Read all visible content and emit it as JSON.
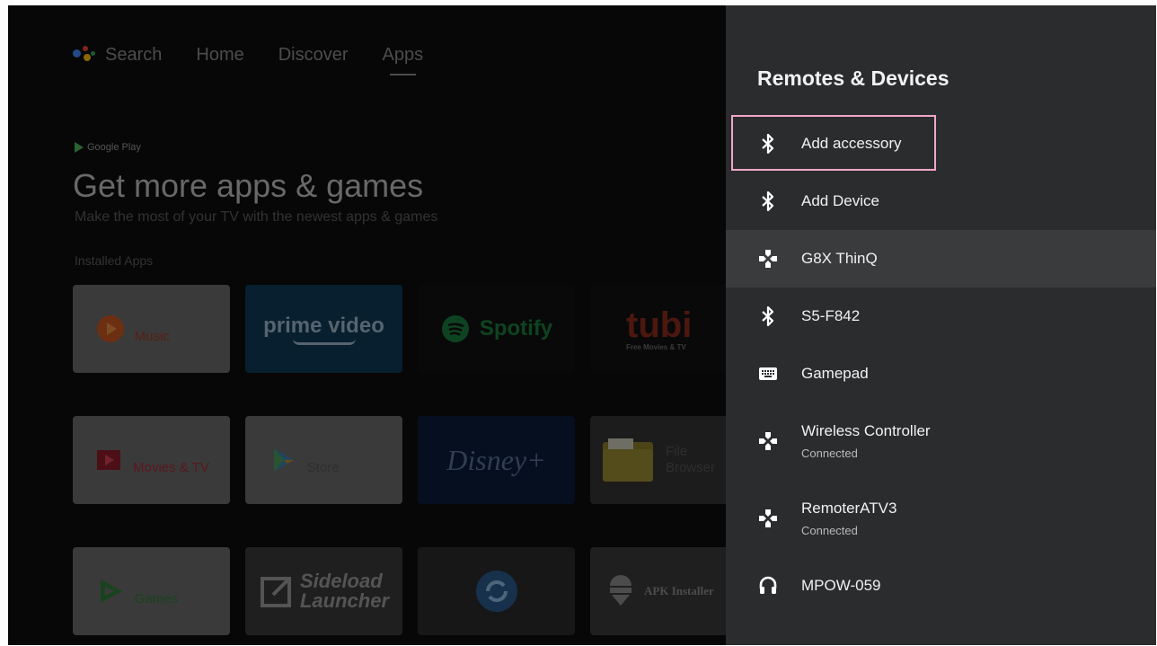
{
  "launcher": {
    "nav": {
      "search_label": "Search",
      "tabs": [
        {
          "label": "Home"
        },
        {
          "label": "Discover"
        },
        {
          "label": "Apps",
          "active": true
        }
      ]
    },
    "google_play_badge": "Google Play",
    "hero_title": "Get more apps & games",
    "hero_subtitle": "Make the most of your TV with the newest apps & games",
    "section_label": "Installed Apps",
    "apps": [
      {
        "line1": "Google Play",
        "line2": "Music"
      },
      {
        "line1": "prime video"
      },
      {
        "line1": "Spotify"
      },
      {
        "line1": "tubi",
        "line2": "Free Movies & TV"
      },
      {
        "line1": "Google Play",
        "line2": "Movies & TV"
      },
      {
        "line1": "Google Play",
        "line2": "Store"
      },
      {
        "line1": "Disney+"
      },
      {
        "line1": "File",
        "line2": "Browser"
      },
      {
        "line1": "Google Play",
        "line2": "Games"
      },
      {
        "line1": "Sideload",
        "line2": "Launcher"
      },
      {
        "line1": ""
      },
      {
        "line1": "APK Installer"
      }
    ]
  },
  "panel": {
    "title": "Remotes & Devices",
    "items": [
      {
        "label": "Add accessory",
        "icon": "bluetooth-icon",
        "focused": true
      },
      {
        "label": "Add Device",
        "icon": "bluetooth-icon"
      },
      {
        "label": "G8X ThinQ",
        "icon": "gamepad-icon",
        "selected": true
      },
      {
        "label": "S5-F842",
        "icon": "bluetooth-icon"
      },
      {
        "label": "Gamepad",
        "icon": "keyboard-icon"
      },
      {
        "label": "Wireless Controller",
        "sub": "Connected",
        "icon": "gamepad-icon"
      },
      {
        "label": "RemoterATV3",
        "sub": "Connected",
        "icon": "gamepad-icon"
      },
      {
        "label": "MPOW-059",
        "icon": "headset-icon"
      }
    ]
  },
  "colors": {
    "panel_bg": "#2b2c2e",
    "focus_ring": "#f0a6c8",
    "selected_row": "#3a3b3d"
  }
}
